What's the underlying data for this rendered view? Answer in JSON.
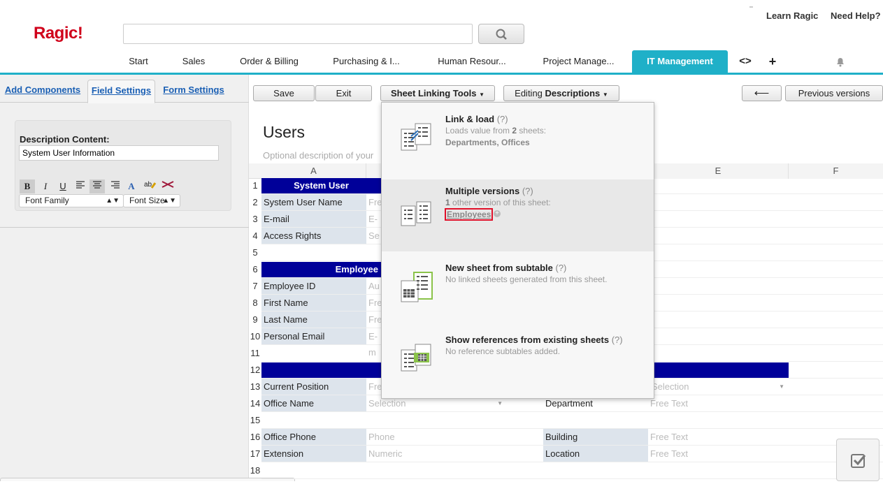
{
  "header": {
    "logo": "Ragic!",
    "learn_link": "Learn Ragic",
    "help_link": "Need Help?",
    "search_placeholder": ""
  },
  "nav": {
    "tabs": [
      "Start",
      "Sales",
      "Order & Billing",
      "Purchasing & I...",
      "Human Resour...",
      "Project Manage...",
      "IT Management"
    ],
    "active": "IT Management",
    "code_glyph": "<>",
    "add_glyph": "+"
  },
  "left_panel": {
    "tabs": [
      "Add Components",
      "Field Settings",
      "Form Settings"
    ],
    "active_tab": "Field Settings",
    "description_label": "Description Content:",
    "description_value": "System User Information",
    "font_family": "Font Family",
    "font_size": "Font Size"
  },
  "toolbar": {
    "save": "Save",
    "exit": "Exit",
    "linking": "Sheet Linking Tools",
    "editing_prefix": "Editing ",
    "editing_mode": "Descriptions",
    "back_glyph": "⟵",
    "previous_versions": "Previous versions"
  },
  "sheet": {
    "title": "Users",
    "description_placeholder": "Optional description of your",
    "columns": [
      "A",
      "E",
      "F"
    ],
    "headers": {
      "system_user": "System User",
      "employee": "Employee"
    },
    "rows": [
      {
        "n": "1"
      },
      {
        "n": "2",
        "label": "System User Name",
        "field": "Fre"
      },
      {
        "n": "3",
        "label": "E-mail",
        "field": "E-m"
      },
      {
        "n": "4",
        "label": "Access Rights",
        "field": "Se"
      },
      {
        "n": "5"
      },
      {
        "n": "6"
      },
      {
        "n": "7",
        "label": "Employee ID",
        "field": "Au"
      },
      {
        "n": "8",
        "label": "First Name",
        "field": "Fre"
      },
      {
        "n": "9",
        "label": "Last Name",
        "field": "Fre"
      },
      {
        "n": "10",
        "label": "Personal Email",
        "field": "E-m"
      },
      {
        "n": "11"
      },
      {
        "n": "12"
      },
      {
        "n": "13",
        "label": "Current Position",
        "field": "Fre",
        "field_e": "Selection"
      },
      {
        "n": "14",
        "label": "Office Name",
        "field": "Selection",
        "label_d": "Department",
        "field_e": "Free Text"
      },
      {
        "n": "15"
      },
      {
        "n": "16",
        "label": "Office Phone",
        "field": "Phone",
        "label_d": "Building",
        "field_e": "Free Text"
      },
      {
        "n": "17",
        "label": "Extension",
        "field": "Numeric",
        "label_d": "Location",
        "field_e": "Free Text"
      },
      {
        "n": "18"
      }
    ]
  },
  "dropdown": {
    "items": [
      {
        "title": "Link & load",
        "q": "(?)",
        "line1_prefix": "Loads value from ",
        "line1_bold": "2",
        "line1_suffix": " sheets:",
        "line2": "Departments, Offices",
        "icon": "link-load-icon"
      },
      {
        "title": "Multiple versions",
        "q": "(?)",
        "line1_bold": "1",
        "line1_suffix": " other version of this sheet:",
        "line2": "Employees",
        "icon": "multiple-versions-icon"
      },
      {
        "title": "New sheet from subtable",
        "q": "(?)",
        "line1": "No linked sheets generated from this sheet.",
        "icon": "subtable-sheet-icon"
      },
      {
        "title": "Show references from existing sheets",
        "q": "(?)",
        "line1": "No reference subtables added.",
        "icon": "references-icon"
      }
    ]
  },
  "colors": {
    "accent": "#1fb0c8",
    "header_bar": "#000099",
    "logo": "#d0021b",
    "highlight": "#e0102a"
  }
}
